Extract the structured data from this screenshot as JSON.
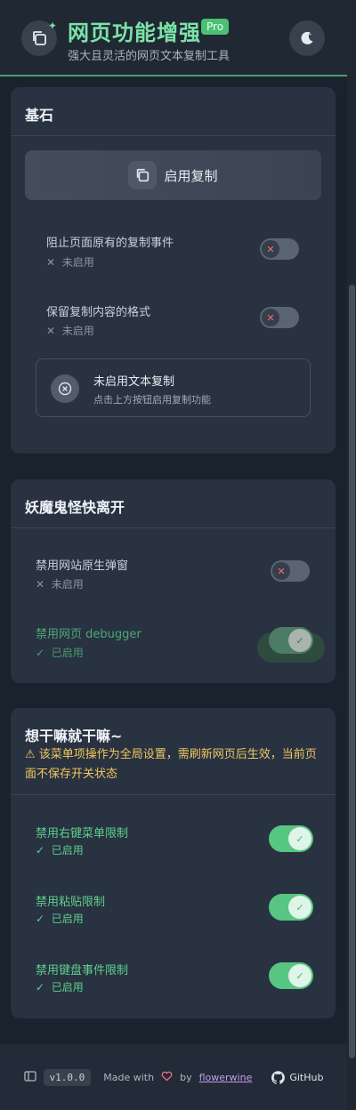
{
  "header": {
    "title": "网页功能增强",
    "badge": "Pro",
    "subtitle": "强大且灵活的网页文本复制工具",
    "sparkle_icon": "sparkle-icon",
    "theme_icon": "moon-icon"
  },
  "colors": {
    "accent_green": "#57c683",
    "title_green": "#7ce2a8",
    "warning": "#f2c760",
    "off_x": "#ef6b74"
  },
  "section_basic": {
    "title": "基石",
    "enable_copy_label": "启用复制",
    "options": [
      {
        "label": "阻止页面原有的复制事件",
        "status": "未启用",
        "status_icon": "✕",
        "enabled": false
      },
      {
        "label": "保留复制内容的格式",
        "status": "未启用",
        "status_icon": "✕",
        "enabled": false
      }
    ],
    "info": {
      "title": "未启用文本复制",
      "subtitle": "点击上方按钮启用复制功能"
    }
  },
  "section_popups": {
    "title": "妖魔鬼怪快离开",
    "options": [
      {
        "label": "禁用网站原生弹窗",
        "status": "未启用",
        "status_icon": "✕",
        "enabled": false
      },
      {
        "label": "禁用网页 debugger",
        "status": "已启用",
        "status_icon": "✓",
        "enabled": true
      }
    ]
  },
  "section_global": {
    "title": "想干嘛就干嘛~",
    "warning": "该菜单项操作为全局设置，需刷新网页后生效，当前页面不保存开关状态",
    "options": [
      {
        "label": "禁用右键菜单限制",
        "status": "已启用",
        "status_icon": "✓",
        "enabled": true
      },
      {
        "label": "禁用粘贴限制",
        "status": "已启用",
        "status_icon": "✓",
        "enabled": true
      },
      {
        "label": "禁用键盘事件限制",
        "status": "已启用",
        "status_icon": "✓",
        "enabled": true
      }
    ]
  },
  "footer": {
    "version": "v1.0.0",
    "made_with": "Made with",
    "by": "by",
    "author": "flowerwine",
    "github": "GitHub"
  }
}
